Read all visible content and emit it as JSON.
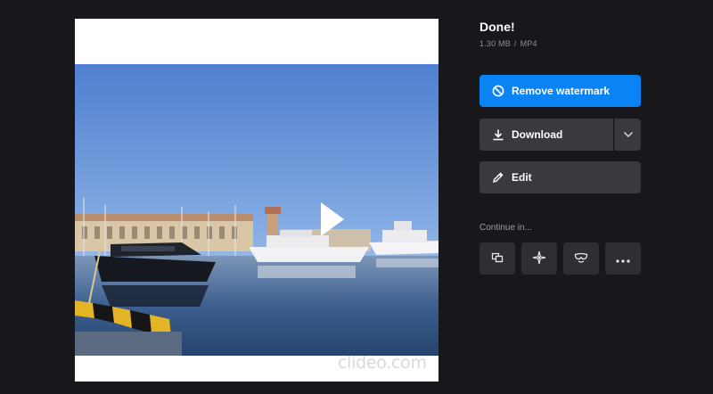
{
  "preview": {
    "watermark": "clideo.com"
  },
  "result": {
    "title": "Done!",
    "file_size": "1.30 MB",
    "separator": "/",
    "format": "MP4"
  },
  "actions": {
    "remove_watermark": "Remove watermark",
    "download": "Download",
    "edit": "Edit"
  },
  "continue": {
    "label": "Continue in...",
    "tools": [
      "merge-icon",
      "sparkle-icon",
      "mask-icon",
      "more-icon"
    ]
  },
  "colors": {
    "background": "#18171c",
    "primary": "#0a84f5",
    "button_dark": "#3a393f",
    "tool_button": "#2f2e34"
  }
}
